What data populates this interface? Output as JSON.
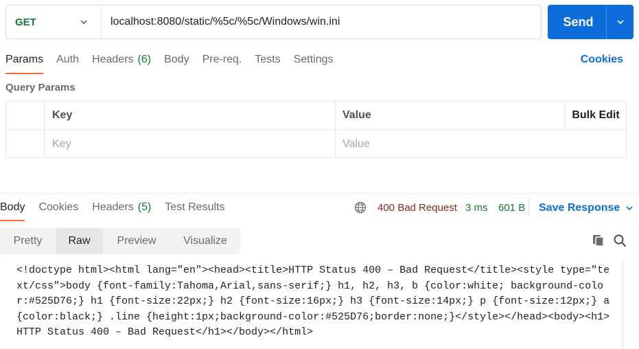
{
  "request": {
    "method": "GET",
    "url": "localhost:8080/static/%5c/%5c/Windows/win.ini",
    "send_label": "Send"
  },
  "request_tabs": [
    {
      "label": "Params",
      "active": true
    },
    {
      "label": "Auth"
    },
    {
      "label": "Headers",
      "count": "(6)"
    },
    {
      "label": "Body"
    },
    {
      "label": "Pre-req."
    },
    {
      "label": "Tests"
    },
    {
      "label": "Settings"
    }
  ],
  "cookies_label": "Cookies",
  "query_params": {
    "title": "Query Params",
    "headers": {
      "key": "Key",
      "value": "Value",
      "bulk_edit": "Bulk Edit"
    },
    "placeholders": {
      "key": "Key",
      "value": "Value"
    }
  },
  "response": {
    "tabs": [
      {
        "label": "Body",
        "active": true
      },
      {
        "label": "Cookies"
      },
      {
        "label": "Headers",
        "count": "(5)"
      },
      {
        "label": "Test Results"
      }
    ],
    "status": "400 Bad Request",
    "time": "3 ms",
    "size": "601 B",
    "save_label": "Save Response",
    "views": [
      "Pretty",
      "Raw",
      "Preview",
      "Visualize"
    ],
    "active_view": "Raw",
    "body": "<!doctype html><html lang=\"en\"><head><title>HTTP Status 400 – Bad Request</title><style type=\"text/css\">body {font-family:Tahoma,Arial,sans-serif;} h1, h2, h3, b {color:white; background-color:#525D76;} h1 {font-size:22px;} h2 {font-size:16px;} h3 {font-size:14px;} p {font-size:12px;} a {color:black;} .line {height:1px;background-color:#525D76;border:none;}</style></head><body><h1>HTTP Status 400 – Bad Request</h1></body></html>"
  },
  "colors": {
    "accent": "#0d6ddb",
    "method_get": "#0f7b2f",
    "active_tab_underline": "#ff6c37",
    "status_error": "#8c2a1a"
  },
  "icons": [
    "chevron-down-icon",
    "globe-icon",
    "copy-icon",
    "search-icon"
  ]
}
